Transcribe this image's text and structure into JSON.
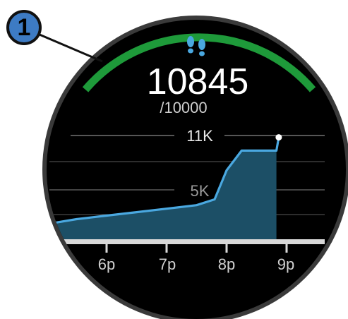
{
  "callout_number": "1",
  "steps": {
    "value": "10845",
    "goal": "/10000"
  },
  "colors": {
    "progress_arc": "#1e9a3a",
    "steps_line": "#4aa8e0",
    "steps_fill": "#1c4f66",
    "steps_icon": "#4aa8e0",
    "callout_fill": "#3d7bc4"
  },
  "icons": {
    "steps": "footsteps-icon"
  },
  "chart_data": {
    "type": "area",
    "y_labels": [
      "11K",
      "5K"
    ],
    "x_labels": [
      "6p",
      "7p",
      "8p",
      "9p"
    ],
    "ylim": [
      0,
      14000
    ],
    "grid": true,
    "x": [
      5.15,
      5.5,
      6.0,
      6.5,
      7.0,
      7.5,
      7.8,
      8.0,
      8.25,
      8.5,
      8.78,
      8.83,
      8.87
    ],
    "series": [
      {
        "values": [
          3500,
          3800,
          4100,
          4400,
          4700,
          5000,
          5500,
          8000,
          9700,
          9700,
          9700,
          9700,
          10845
        ]
      }
    ]
  }
}
